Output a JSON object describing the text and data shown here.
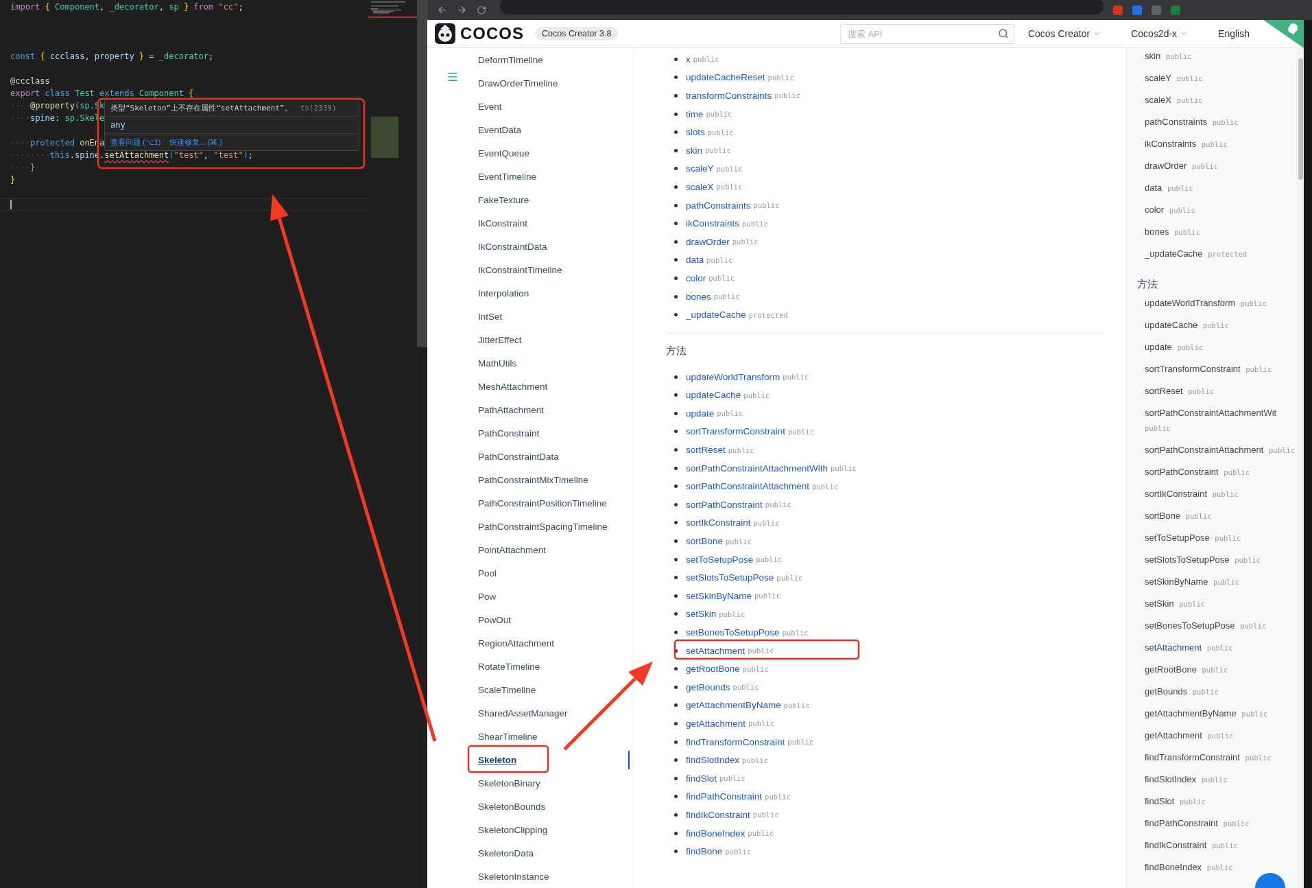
{
  "editor": {
    "lines": [
      {
        "current": false,
        "tokens": [
          {
            "t": "import ",
            "kind": "keyword"
          },
          {
            "t": "{ ",
            "kind": "brace"
          },
          {
            "t": "Component",
            "kind": "type"
          },
          {
            "t": ", ",
            "kind": "plain"
          },
          {
            "t": "_decorator",
            "kind": "type"
          },
          {
            "t": ", ",
            "kind": "plain"
          },
          {
            "t": "sp",
            "kind": "type"
          },
          {
            "t": " } ",
            "kind": "brace"
          },
          {
            "t": "from ",
            "kind": "keyword"
          },
          {
            "t": "\"cc\"",
            "kind": "string"
          },
          {
            "t": ";",
            "kind": "plain"
          }
        ]
      },
      {
        "current": false
      },
      {
        "current": false
      },
      {
        "current": false
      },
      {
        "current": false,
        "tokens": [
          {
            "t": "const ",
            "kind": "storage"
          },
          {
            "t": "{ ",
            "kind": "brace"
          },
          {
            "t": "ccclass",
            "kind": "var"
          },
          {
            "t": ", ",
            "kind": "plain"
          },
          {
            "t": "property",
            "kind": "var"
          },
          {
            "t": " } ",
            "kind": "brace"
          },
          {
            "t": "= ",
            "kind": "plain"
          },
          {
            "t": "_decorator",
            "kind": "type"
          },
          {
            "t": ";",
            "kind": "plain"
          }
        ]
      },
      {
        "current": false
      },
      {
        "current": false,
        "tokens": [
          {
            "t": "@ccclass",
            "kind": "plain"
          }
        ]
      },
      {
        "current": false,
        "tokens": [
          {
            "t": "export ",
            "kind": "keyword"
          },
          {
            "t": "class ",
            "kind": "storage"
          },
          {
            "t": "Test ",
            "kind": "type"
          },
          {
            "t": "extends ",
            "kind": "storage"
          },
          {
            "t": "Component ",
            "kind": "type"
          },
          {
            "t": "{",
            "kind": "brace"
          }
        ]
      },
      {
        "current": false,
        "tokens": [
          {
            "t": "····",
            "kind": "ws"
          },
          {
            "t": "@property",
            "kind": "fn"
          },
          {
            "t": "(",
            "kind": "brace2"
          },
          {
            "t": "sp.Sk",
            "kind": "type"
          }
        ]
      },
      {
        "current": false,
        "tokens": [
          {
            "t": "····",
            "kind": "ws"
          },
          {
            "t": "spine",
            "kind": "var"
          },
          {
            "t": ": ",
            "kind": "plain"
          },
          {
            "t": "sp.Skele",
            "kind": "type"
          }
        ]
      },
      {
        "current": false
      },
      {
        "current": false,
        "tokens": [
          {
            "t": "····",
            "kind": "ws"
          },
          {
            "t": "protected ",
            "kind": "storage"
          },
          {
            "t": "onEna",
            "kind": "fn"
          }
        ]
      },
      {
        "current": false,
        "tokens": [
          {
            "t": "········",
            "kind": "ws"
          },
          {
            "t": "this",
            "kind": "storage"
          },
          {
            "t": ".",
            "kind": "plain"
          },
          {
            "t": "spine",
            "kind": "var"
          },
          {
            "t": ".",
            "kind": "plain"
          },
          {
            "t": "setAttachment",
            "kind": "fn",
            "error": true
          },
          {
            "t": "(",
            "kind": "brace3"
          },
          {
            "t": "\"test\"",
            "kind": "string"
          },
          {
            "t": ", ",
            "kind": "plain"
          },
          {
            "t": "\"test\"",
            "kind": "string"
          },
          {
            "t": ")",
            "kind": "brace3"
          },
          {
            "t": ";",
            "kind": "plain"
          }
        ]
      },
      {
        "current": false,
        "tokens": [
          {
            "t": "····",
            "kind": "ws"
          },
          {
            "t": "}",
            "kind": "brace2"
          }
        ]
      },
      {
        "current": false,
        "tokens": [
          {
            "t": "}",
            "kind": "brace"
          }
        ]
      },
      {
        "current": false
      },
      {
        "current": true
      }
    ],
    "hover": {
      "message": "类型“Skeleton”上不存在属性“setAttachment”。",
      "code": "ts(2339)",
      "type": "any",
      "actions": [
        "查看问题 (⌥1)",
        "快速修复... (⌘.)"
      ]
    }
  },
  "header": {
    "logo": "COCOS",
    "version": "Cocos Creator 3.8",
    "search": {
      "placeholder": "搜索 API"
    },
    "menus": [
      {
        "label": "Cocos Creator",
        "dropdown": true
      },
      {
        "label": "Cocos2d-x",
        "dropdown": true
      },
      {
        "label": "English",
        "dropdown": false
      }
    ]
  },
  "sidebar": {
    "items": [
      {
        "label": "DeformTimeline",
        "selected": false
      },
      {
        "label": "DrawOrderTimeline",
        "selected": false
      },
      {
        "label": "Event",
        "selected": false
      },
      {
        "label": "EventData",
        "selected": false
      },
      {
        "label": "EventQueue",
        "selected": false
      },
      {
        "label": "EventTimeline",
        "selected": false
      },
      {
        "label": "FakeTexture",
        "selected": false
      },
      {
        "label": "IkConstraint",
        "selected": false
      },
      {
        "label": "IkConstraintData",
        "selected": false
      },
      {
        "label": "IkConstraintTimeline",
        "selected": false
      },
      {
        "label": "Interpolation",
        "selected": false
      },
      {
        "label": "IntSet",
        "selected": false
      },
      {
        "label": "JitterEffect",
        "selected": false
      },
      {
        "label": "MathUtils",
        "selected": false
      },
      {
        "label": "MeshAttachment",
        "selected": false
      },
      {
        "label": "PathAttachment",
        "selected": false
      },
      {
        "label": "PathConstraint",
        "selected": false
      },
      {
        "label": "PathConstraintData",
        "selected": false
      },
      {
        "label": "PathConstraintMixTimeline",
        "selected": false
      },
      {
        "label": "PathConstraintPositionTimeline",
        "selected": false
      },
      {
        "label": "PathConstraintSpacingTimeline",
        "selected": false
      },
      {
        "label": "PointAttachment",
        "selected": false
      },
      {
        "label": "Pool",
        "selected": false
      },
      {
        "label": "Pow",
        "selected": false
      },
      {
        "label": "PowOut",
        "selected": false
      },
      {
        "label": "RegionAttachment",
        "selected": false
      },
      {
        "label": "RotateTimeline",
        "selected": false
      },
      {
        "label": "ScaleTimeline",
        "selected": false
      },
      {
        "label": "SharedAssetManager",
        "selected": false
      },
      {
        "label": "ShearTimeline",
        "selected": false
      },
      {
        "label": "Skeleton",
        "selected": true
      },
      {
        "label": "SkeletonBinary",
        "selected": false
      },
      {
        "label": "SkeletonBounds",
        "selected": false
      },
      {
        "label": "SkeletonClipping",
        "selected": false
      },
      {
        "label": "SkeletonData",
        "selected": false
      },
      {
        "label": "SkeletonInstance",
        "selected": false
      }
    ]
  },
  "content": {
    "properties": [
      {
        "name": "x",
        "access": "public"
      },
      {
        "name": "updateCacheReset",
        "access": "public"
      },
      {
        "name": "transformConstraints",
        "access": "public"
      },
      {
        "name": "time",
        "access": "public"
      },
      {
        "name": "slots",
        "access": "public"
      },
      {
        "name": "skin",
        "access": "public"
      },
      {
        "name": "scaleY",
        "access": "public"
      },
      {
        "name": "scaleX",
        "access": "public"
      },
      {
        "name": "pathConstraints",
        "access": "public"
      },
      {
        "name": "ikConstraints",
        "access": "public"
      },
      {
        "name": "drawOrder",
        "access": "public"
      },
      {
        "name": "data",
        "access": "public"
      },
      {
        "name": "color",
        "access": "public"
      },
      {
        "name": "bones",
        "access": "public"
      },
      {
        "name": "_updateCache",
        "access": "protected"
      }
    ],
    "methods_heading": "方法",
    "methods": [
      {
        "name": "updateWorldTransform",
        "access": "public"
      },
      {
        "name": "updateCache",
        "access": "public"
      },
      {
        "name": "update",
        "access": "public"
      },
      {
        "name": "sortTransformConstraint",
        "access": "public"
      },
      {
        "name": "sortReset",
        "access": "public"
      },
      {
        "name": "sortPathConstraintAttachmentWith",
        "access": "public"
      },
      {
        "name": "sortPathConstraintAttachment",
        "access": "public"
      },
      {
        "name": "sortPathConstraint",
        "access": "public"
      },
      {
        "name": "sortIkConstraint",
        "access": "public"
      },
      {
        "name": "sortBone",
        "access": "public"
      },
      {
        "name": "setToSetupPose",
        "access": "public"
      },
      {
        "name": "setSlotsToSetupPose",
        "access": "public"
      },
      {
        "name": "setSkinByName",
        "access": "public"
      },
      {
        "name": "setSkin",
        "access": "public"
      },
      {
        "name": "setBonesToSetupPose",
        "access": "public"
      },
      {
        "name": "setAttachment",
        "access": "public"
      },
      {
        "name": "getRootBone",
        "access": "public"
      },
      {
        "name": "getBounds",
        "access": "public"
      },
      {
        "name": "getAttachmentByName",
        "access": "public"
      },
      {
        "name": "getAttachment",
        "access": "public"
      },
      {
        "name": "findTransformConstraint",
        "access": "public"
      },
      {
        "name": "findSlotIndex",
        "access": "public"
      },
      {
        "name": "findSlot",
        "access": "public"
      },
      {
        "name": "findPathConstraint",
        "access": "public"
      },
      {
        "name": "findIkConstraint",
        "access": "public"
      },
      {
        "name": "findBoneIndex",
        "access": "public"
      },
      {
        "name": "findBone",
        "access": "public"
      }
    ]
  },
  "toc": {
    "properties": [
      {
        "name": "skin",
        "access": "public"
      },
      {
        "name": "scaleY",
        "access": "public"
      },
      {
        "name": "scaleX",
        "access": "public"
      },
      {
        "name": "pathConstraints",
        "access": "public"
      },
      {
        "name": "ikConstraints",
        "access": "public"
      },
      {
        "name": "drawOrder",
        "access": "public"
      },
      {
        "name": "data",
        "access": "public"
      },
      {
        "name": "color",
        "access": "public"
      },
      {
        "name": "bones",
        "access": "public"
      },
      {
        "name": "_updateCache",
        "access": "protected"
      }
    ],
    "methods_heading": "方法",
    "methods": [
      {
        "name": "updateWorldTransform",
        "access": "public",
        "selected": false
      },
      {
        "name": "updateCache",
        "access": "public",
        "selected": false
      },
      {
        "name": "update",
        "access": "public",
        "selected": false
      },
      {
        "name": "sortTransformConstraint",
        "access": "public",
        "selected": false
      },
      {
        "name": "sortReset",
        "access": "public",
        "selected": false
      },
      {
        "name": "sortPathConstraintAttachmentWit",
        "access": "public",
        "selected": false
      },
      {
        "name": "sortPathConstraintAttachment",
        "access": "public",
        "selected": false
      },
      {
        "name": "sortPathConstraint",
        "access": "public",
        "selected": false
      },
      {
        "name": "sortIkConstraint",
        "access": "public",
        "selected": false
      },
      {
        "name": "sortBone",
        "access": "public",
        "selected": false
      },
      {
        "name": "setToSetupPose",
        "access": "public",
        "selected": false
      },
      {
        "name": "setSlotsToSetupPose",
        "access": "public",
        "selected": false
      },
      {
        "name": "setSkinByName",
        "access": "public",
        "selected": false
      },
      {
        "name": "setSkin",
        "access": "public",
        "selected": false
      },
      {
        "name": "setBonesToSetupPose",
        "access": "public",
        "selected": false
      },
      {
        "name": "setAttachment",
        "access": "public",
        "selected": true
      },
      {
        "name": "getRootBone",
        "access": "public",
        "selected": false
      },
      {
        "name": "getBounds",
        "access": "public",
        "selected": false
      },
      {
        "name": "getAttachmentByName",
        "access": "public",
        "selected": false
      },
      {
        "name": "getAttachment",
        "access": "public",
        "selected": false
      },
      {
        "name": "findTransformConstraint",
        "access": "public",
        "selected": false
      },
      {
        "name": "findSlotIndex",
        "access": "public",
        "selected": false
      },
      {
        "name": "findSlot",
        "access": "public",
        "selected": false
      },
      {
        "name": "findPathConstraint",
        "access": "public",
        "selected": false
      },
      {
        "name": "findIkConstraint",
        "access": "public",
        "selected": false
      },
      {
        "name": "findBoneIndex",
        "access": "public",
        "selected": false
      }
    ]
  }
}
